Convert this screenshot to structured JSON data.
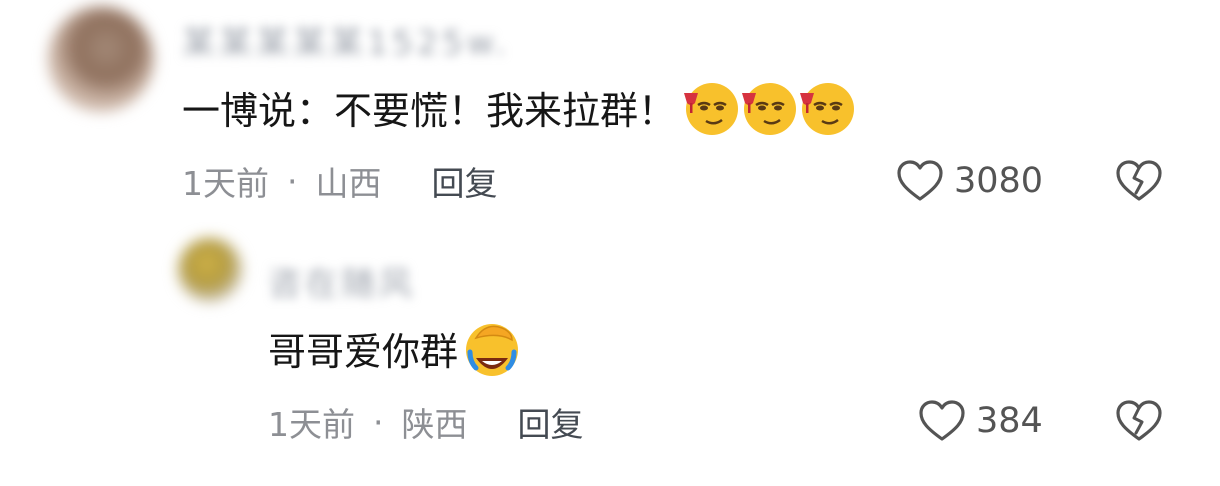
{
  "comments": [
    {
      "username": "某某某某某1525w.",
      "text": "一博说：不要慌！我来拉群！",
      "emojis": [
        "smirk-wine-emoji",
        "smirk-wine-emoji",
        "smirk-wine-emoji"
      ],
      "time": "1天前",
      "separator": "·",
      "location": "山西",
      "reply_label": "回复",
      "likes": "3080"
    },
    {
      "username": "咨在随风",
      "text": "哥哥爱你群",
      "emojis": [
        "facepalm-laugh-emoji"
      ],
      "time": "1天前",
      "separator": "·",
      "location": "陕西",
      "reply_label": "回复",
      "likes": "384"
    }
  ],
  "colors": {
    "text": "#161616",
    "meta": "#8d8f94",
    "icon": "#545454",
    "emoji_face": "#f8c12c"
  }
}
